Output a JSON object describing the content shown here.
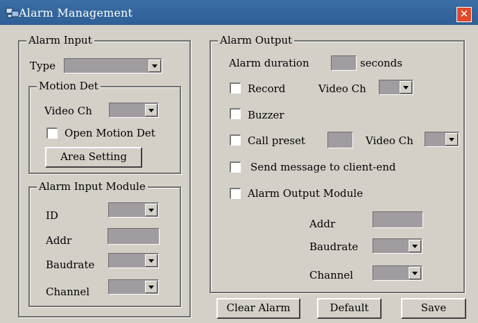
{
  "window": {
    "title": "Alarm Management",
    "close_glyph": "✕"
  },
  "alarm_input": {
    "legend": "Alarm Input",
    "type_label": "Type",
    "motion_det": {
      "legend": "Motion Det",
      "video_ch_label": "Video Ch",
      "open_motion_label": "Open Motion Det",
      "area_setting_label": "Area Setting"
    },
    "module": {
      "legend": "Alarm Input Module",
      "id_label": "ID",
      "addr_label": "Addr",
      "baudrate_label": "Baudrate",
      "channel_label": "Channel"
    }
  },
  "alarm_output": {
    "legend": "Alarm Output",
    "duration_label": "Alarm duration",
    "seconds_label": "seconds",
    "record_label": "Record",
    "video_ch_label": "Video Ch",
    "buzzer_label": "Buzzer",
    "call_preset_label": "Call preset",
    "video_ch2_label": "Video Ch",
    "send_message_label": "Send message to client-end",
    "output_module_label": "Alarm Output Module",
    "addr_label": "Addr",
    "baudrate_label": "Baudrate",
    "channel_label": "Channel"
  },
  "buttons": {
    "clear_alarm": "Clear Alarm",
    "default": "Default",
    "save": "Save"
  },
  "colors": {
    "title_bar": "#2f5f96",
    "close_button": "#e04a2a",
    "panel_bg": "#d4d0c8",
    "field_bg": "#a09ca0"
  },
  "icons": {
    "app_icon": "network-computer-icon",
    "close_icon": "close-icon",
    "dropdown_icon": "chevron-down-icon"
  }
}
